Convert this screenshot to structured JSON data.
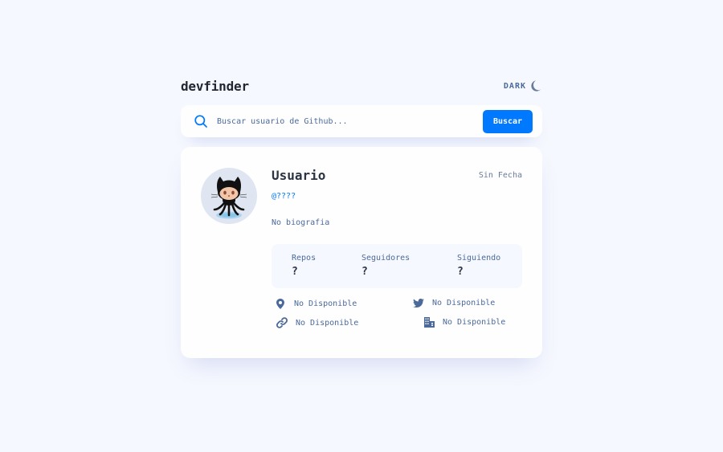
{
  "header": {
    "logo": "devfinder",
    "theme_label": "DARK",
    "theme_icon": "moon-icon"
  },
  "search": {
    "placeholder": "Buscar usuario de Github...",
    "value": "",
    "button_label": "Buscar",
    "icon": "search-icon"
  },
  "profile": {
    "name": "Usuario",
    "joined": "Sin Fecha",
    "login": "@????",
    "bio": "No biografia",
    "avatar": "octocat"
  },
  "stats": [
    {
      "label": "Repos",
      "value": "?"
    },
    {
      "label": "Seguidores",
      "value": "?"
    },
    {
      "label": "Siguiendo",
      "value": "?"
    }
  ],
  "links": {
    "location": {
      "icon": "location-pin-icon",
      "text": "No Disponible"
    },
    "twitter": {
      "icon": "twitter-icon",
      "text": "No Disponible"
    },
    "website": {
      "icon": "link-icon",
      "text": "No Disponible"
    },
    "company": {
      "icon": "building-icon",
      "text": "No Disponible"
    }
  },
  "colors": {
    "background": "#f6f8ff",
    "accent": "#0079ff",
    "text": "#4b6a9b",
    "heading": "#2b3442"
  }
}
